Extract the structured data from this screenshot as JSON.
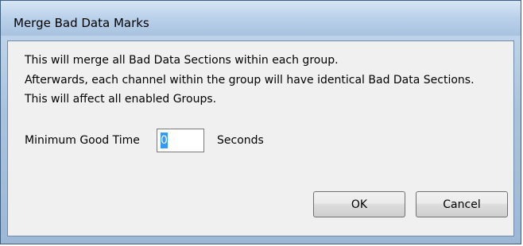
{
  "window": {
    "title": "Merge Bad Data Marks"
  },
  "message": {
    "line1": "This will merge all Bad Data Sections within each group.",
    "line2": "Afterwards, each channel within the group will have identical Bad Data Sections.",
    "line3": "This will affect all enabled Groups."
  },
  "min_good_time": {
    "label": "Minimum Good Time",
    "value": "0",
    "unit": "Seconds"
  },
  "buttons": {
    "ok_label": "OK",
    "cancel_label": "Cancel"
  },
  "colors": {
    "titlebar": "#bad1ea",
    "client_bg": "#f0f0f0",
    "selection": "#3399ff"
  }
}
